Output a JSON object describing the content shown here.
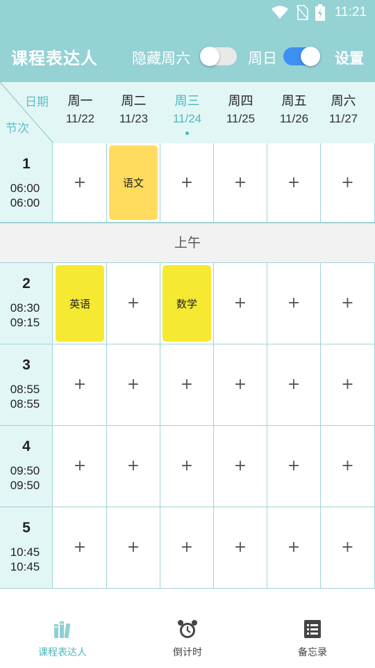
{
  "status_bar": {
    "time": "11:21",
    "icons": [
      "wifi-icon",
      "no-sim-icon",
      "battery-charging-icon"
    ]
  },
  "app_bar": {
    "title": "课程表达人",
    "hide_saturday_label": "隐藏周六",
    "hide_saturday_on": false,
    "sunday_label": "周日",
    "sunday_on": true,
    "settings_label": "设置"
  },
  "header": {
    "corner_date": "日期",
    "corner_section": "节次",
    "days": [
      {
        "name": "周一",
        "date": "11/22",
        "today": false
      },
      {
        "name": "周二",
        "date": "11/23",
        "today": false
      },
      {
        "name": "周三",
        "date": "11/24",
        "today": true
      },
      {
        "name": "周四",
        "date": "11/25",
        "today": false
      },
      {
        "name": "周五",
        "date": "11/26",
        "today": false
      },
      {
        "name": "周六",
        "date": "11/27",
        "today": false
      }
    ]
  },
  "add_symbol": "+",
  "period_band": "上午",
  "sections": [
    {
      "num": "1",
      "start": "06:00",
      "end": "06:00",
      "courses": {
        "1": "语文"
      }
    },
    {
      "num": "2",
      "start": "08:30",
      "end": "09:15",
      "courses": {
        "0": "英语",
        "2": "数学"
      }
    },
    {
      "num": "3",
      "start": "08:55",
      "end": "08:55",
      "courses": {}
    },
    {
      "num": "4",
      "start": "09:50",
      "end": "09:50",
      "courses": {}
    },
    {
      "num": "5",
      "start": "10:45",
      "end": "10:45",
      "courses": {}
    }
  ],
  "course_colors": {
    "语文": "#ffdb5e",
    "英语": "#f5e932",
    "数学": "#f5e932"
  },
  "colors": {
    "accent": "#94d2d4",
    "today": "#49b8bc",
    "toggle_on": "#3d8ff2"
  },
  "bottom_nav": [
    {
      "label": "课程表达人",
      "icon": "books-icon",
      "active": true
    },
    {
      "label": "倒计时",
      "icon": "alarm-clock-icon",
      "active": false
    },
    {
      "label": "备忘录",
      "icon": "list-icon",
      "active": false
    }
  ]
}
